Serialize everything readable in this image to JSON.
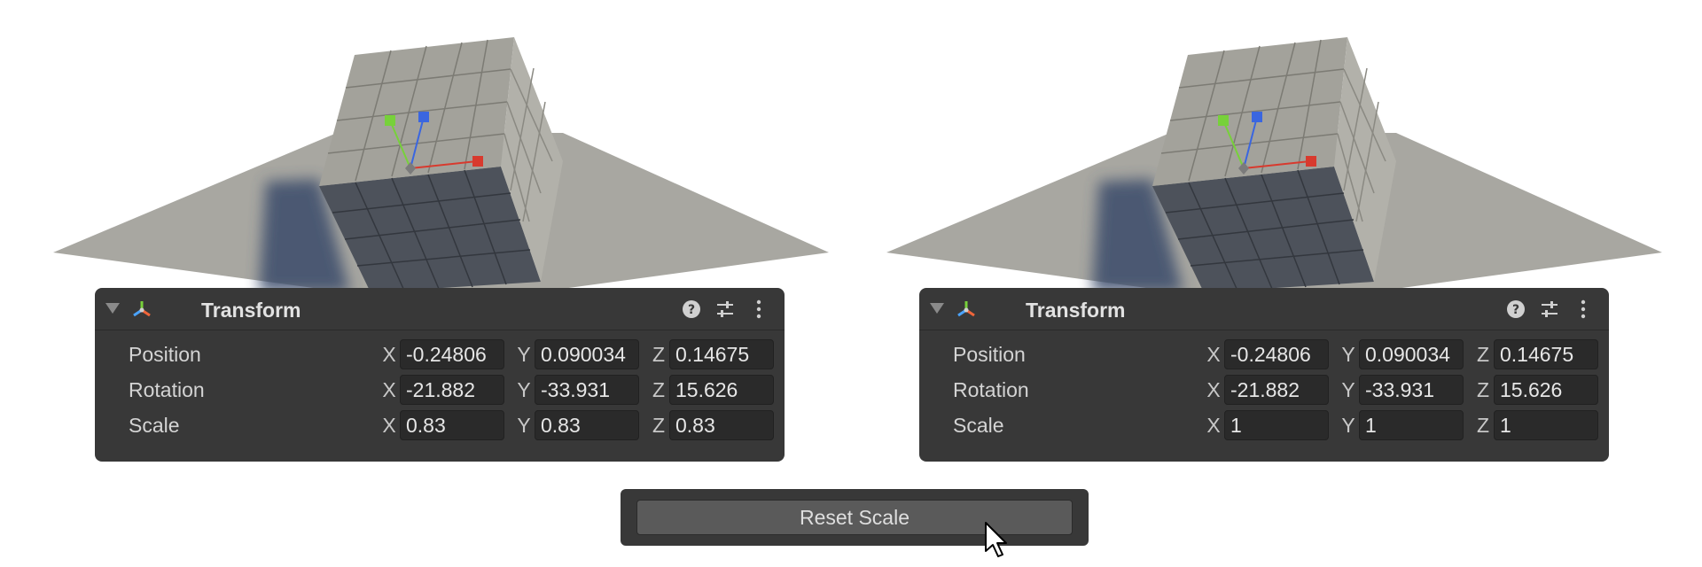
{
  "panels": [
    {
      "title": "Transform",
      "rows": [
        {
          "label": "Position",
          "x": "-0.24806",
          "y": "0.090034",
          "z": "0.14675"
        },
        {
          "label": "Rotation",
          "x": "-21.882",
          "y": "-33.931",
          "z": "15.626"
        },
        {
          "label": "Scale",
          "x": "0.83",
          "y": "0.83",
          "z": "0.83"
        }
      ]
    },
    {
      "title": "Transform",
      "rows": [
        {
          "label": "Position",
          "x": "-0.24806",
          "y": "0.090034",
          "z": "0.14675"
        },
        {
          "label": "Rotation",
          "x": "-21.882",
          "y": "-33.931",
          "z": "15.626"
        },
        {
          "label": "Scale",
          "x": "1",
          "y": "1",
          "z": "1"
        }
      ]
    }
  ],
  "axis_labels": {
    "x": "X",
    "y": "Y",
    "z": "Z"
  },
  "reset_button": {
    "label": "Reset Scale"
  },
  "icons": {
    "foldout": "triangle-down-icon",
    "component": "transform-icon",
    "help": "help-icon",
    "presets": "presets-icon",
    "more": "more-vertical-icon",
    "cursor": "mouse-pointer-icon"
  },
  "colors": {
    "panel_bg": "#383838",
    "field_bg": "#2a2a2a",
    "axis_x": "#d83a2e",
    "axis_y": "#77d13a",
    "axis_z": "#3a66e0"
  }
}
